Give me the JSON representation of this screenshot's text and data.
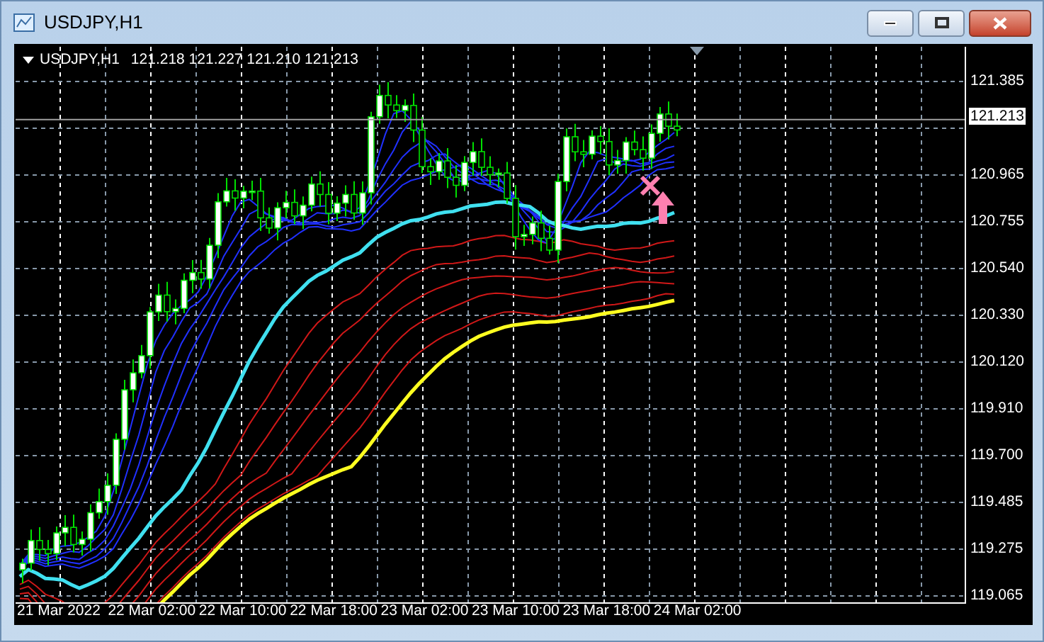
{
  "window": {
    "title": "USDJPY,H1"
  },
  "chart": {
    "symbol": "USDJPY,H1",
    "quote": "121.218 121.227 121.210 121.213",
    "current_price": "121.213",
    "price_labels": [
      "121.385",
      "120.965",
      "120.755",
      "120.540",
      "120.330",
      "120.120",
      "119.910",
      "119.700",
      "119.485",
      "119.275",
      "119.065"
    ],
    "time_labels": [
      "21 Mar 2022",
      "22 Mar 02:00",
      "22 Mar 10:00",
      "22 Mar 18:00",
      "23 Mar 02:00",
      "23 Mar 10:00",
      "23 Mar 18:00",
      "24 Mar 02:00"
    ]
  }
}
